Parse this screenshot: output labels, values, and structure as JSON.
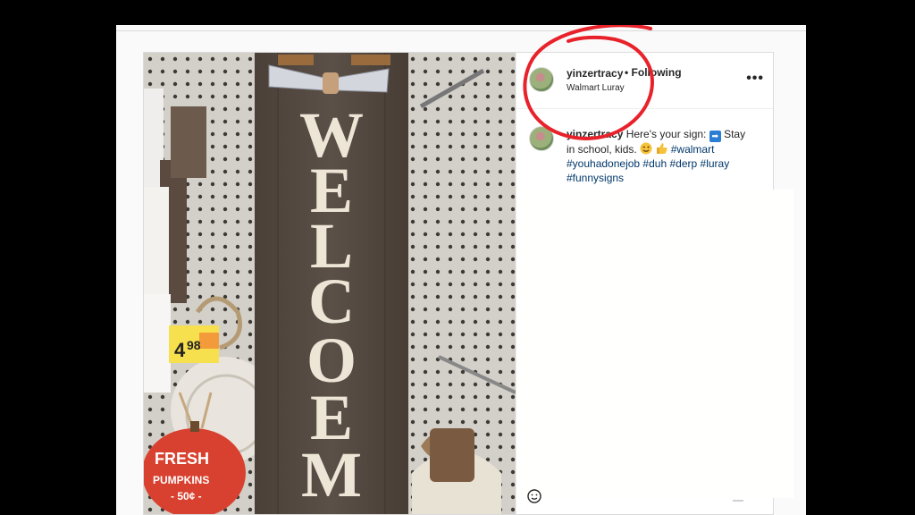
{
  "post": {
    "username": "yinzertracy",
    "following_label": "• Following",
    "location": "Walmart Luray",
    "more_icon": "more-options-icon",
    "more_glyph": "•••"
  },
  "caption": {
    "username": "yinzertracy",
    "text_1": "Here's your sign:",
    "text_2": "Stay in school, kids.",
    "hashtags": [
      "#walmart",
      "#youhadonejob",
      "#duh",
      "#derp",
      "#luray",
      "#funnysigns"
    ]
  },
  "photo": {
    "sign_letters": [
      "W",
      "E",
      "L",
      "C",
      "O",
      "E",
      "M"
    ],
    "price_tag": "4.98",
    "price_tag_main": "4",
    "price_tag_cents": "98",
    "pumpkin_sign_line1": "FRESH",
    "pumpkin_sign_line2": "PUMPKINS",
    "pumpkin_sign_line3": "- 50¢ -"
  },
  "colors": {
    "annotation_circle": "#e8222b",
    "hashtag": "#00376b",
    "background": "#000000"
  }
}
